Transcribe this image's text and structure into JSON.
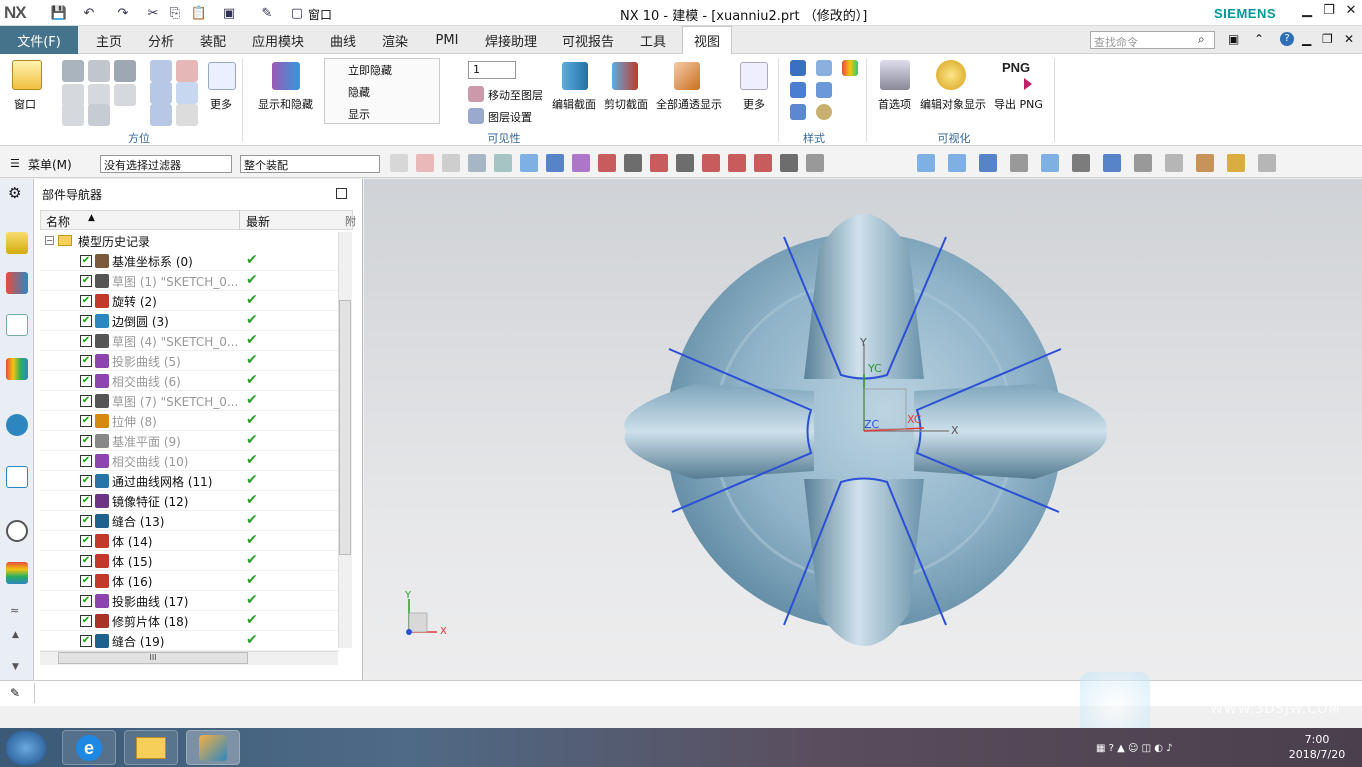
{
  "titlebar": {
    "logo": "NX",
    "title": "NX 10 - 建模 - [xuanniu2.prt （修改的）]",
    "brand": "SIEMENS",
    "window_menu": "窗口"
  },
  "menu": {
    "file": "文件(F)",
    "tabs": [
      "主页",
      "分析",
      "装配",
      "应用模块",
      "曲线",
      "渲染",
      "PMI",
      "焊接助理",
      "可视报告",
      "工具",
      "视图"
    ],
    "active": "视图",
    "search_placeholder": "查找命令"
  },
  "ribbon": {
    "window_label": "窗口",
    "more1": "更多",
    "group_orient": "方位",
    "show_hide": "显示和隐藏",
    "hide_now": "立即隐藏",
    "hide": "隐藏",
    "show": "显示",
    "layer_value": "1",
    "move_to_layer": "移动至图层",
    "layer_settings": "图层设置",
    "group_visibility": "可见性",
    "edit_section": "编辑截面",
    "clip_section": "剪切截面",
    "all_through": "全部通透显示",
    "more2": "更多",
    "group_style": "样式",
    "preferences": "首选项",
    "edit_obj_display": "编辑对象显示",
    "export_png": "导出 PNG",
    "png_text": "PNG",
    "group_visualize": "可视化"
  },
  "toolbar": {
    "menu_label": "菜单(M)",
    "filter": "没有选择过滤器",
    "scope": "整个装配"
  },
  "navigator": {
    "title": "部件导航器",
    "col_name": "名称",
    "col_latest": "最新",
    "col_extra": "附",
    "root": "模型历史记录",
    "items": [
      {
        "label": "基准坐标系 (0)",
        "dim": false,
        "color": "#7a5a3a"
      },
      {
        "label": "草图 (1) \"SKETCH_0...",
        "dim": true,
        "color": "#555"
      },
      {
        "label": "旋转 (2)",
        "dim": false,
        "color": "#c0392b"
      },
      {
        "label": "边倒圆 (3)",
        "dim": false,
        "color": "#2e86c1"
      },
      {
        "label": "草图 (4) \"SKETCH_0...",
        "dim": true,
        "color": "#555"
      },
      {
        "label": "投影曲线 (5)",
        "dim": true,
        "color": "#8e44ad"
      },
      {
        "label": "相交曲线 (6)",
        "dim": true,
        "color": "#8e44ad"
      },
      {
        "label": "草图 (7) \"SKETCH_0...",
        "dim": true,
        "color": "#555"
      },
      {
        "label": "拉伸 (8)",
        "dim": true,
        "color": "#d68910"
      },
      {
        "label": "基准平面 (9)",
        "dim": true,
        "color": "#888"
      },
      {
        "label": "相交曲线 (10)",
        "dim": true,
        "color": "#8e44ad"
      },
      {
        "label": "通过曲线网格 (11)",
        "dim": false,
        "color": "#2874a6"
      },
      {
        "label": "镜像特征 (12)",
        "dim": false,
        "color": "#6c3483"
      },
      {
        "label": "缝合 (13)",
        "dim": false,
        "color": "#1f618d"
      },
      {
        "label": "体 (14)",
        "dim": false,
        "color": "#c0392b"
      },
      {
        "label": "体 (15)",
        "dim": false,
        "color": "#c0392b"
      },
      {
        "label": "体 (16)",
        "dim": false,
        "color": "#c0392b"
      },
      {
        "label": "投影曲线 (17)",
        "dim": false,
        "color": "#8e44ad"
      },
      {
        "label": "修剪片体 (18)",
        "dim": false,
        "color": "#a93226"
      },
      {
        "label": "缝合 (19)",
        "dim": false,
        "color": "#1f618d"
      }
    ],
    "check": "✔",
    "scroll_mid": "III"
  },
  "viewport": {
    "axis_y": "Y",
    "axis_yc": "YC",
    "axis_zc": "ZC",
    "axis_xc": "XC",
    "axis_x": "X",
    "mini_y": "Y",
    "mini_x": "X"
  },
  "taskbar": {
    "time": "7:00",
    "date": "2018/7/20",
    "watermark": "WWW.3DSJW.COM"
  },
  "colors": {
    "accent": "#46738c",
    "model": "#8fb3c8",
    "edge": "#2b4fd6"
  }
}
